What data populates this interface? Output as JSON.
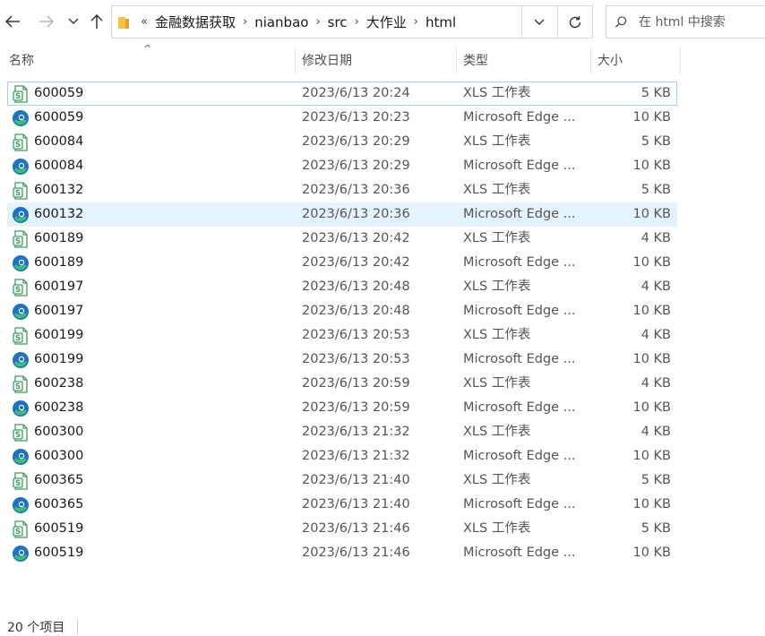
{
  "nav": {
    "back_icon": "arrow-left-icon",
    "forward_icon": "arrow-right-icon",
    "recent_icon": "chevron-down-icon",
    "up_icon": "arrow-up-icon"
  },
  "address": {
    "overflow": "«",
    "crumbs": [
      "金融数据获取",
      "nianbao",
      "src",
      "大作业",
      "html"
    ]
  },
  "search": {
    "placeholder": "在 html 中搜索"
  },
  "columns": {
    "name": "名称",
    "modified": "修改日期",
    "type": "类型",
    "size": "大小"
  },
  "colors": {
    "xls_icon": "#3a9d5a",
    "edge_blue": "#1a73c8",
    "edge_green": "#3fbf6f",
    "selection_border": "#99d1ff",
    "hover_bg": "#e5f3ff"
  },
  "files": [
    {
      "name": "600059",
      "modified": "2023/6/13 20:24",
      "type": "XLS 工作表",
      "size": "5 KB",
      "icon": "xls-icon"
    },
    {
      "name": "600059",
      "modified": "2023/6/13 20:23",
      "type": "Microsoft Edge ...",
      "size": "10 KB",
      "icon": "edge-icon"
    },
    {
      "name": "600084",
      "modified": "2023/6/13 20:29",
      "type": "XLS 工作表",
      "size": "5 KB",
      "icon": "xls-icon"
    },
    {
      "name": "600084",
      "modified": "2023/6/13 20:29",
      "type": "Microsoft Edge ...",
      "size": "10 KB",
      "icon": "edge-icon"
    },
    {
      "name": "600132",
      "modified": "2023/6/13 20:36",
      "type": "XLS 工作表",
      "size": "5 KB",
      "icon": "xls-icon"
    },
    {
      "name": "600132",
      "modified": "2023/6/13 20:36",
      "type": "Microsoft Edge ...",
      "size": "10 KB",
      "icon": "edge-icon"
    },
    {
      "name": "600189",
      "modified": "2023/6/13 20:42",
      "type": "XLS 工作表",
      "size": "4 KB",
      "icon": "xls-icon"
    },
    {
      "name": "600189",
      "modified": "2023/6/13 20:42",
      "type": "Microsoft Edge ...",
      "size": "10 KB",
      "icon": "edge-icon"
    },
    {
      "name": "600197",
      "modified": "2023/6/13 20:48",
      "type": "XLS 工作表",
      "size": "4 KB",
      "icon": "xls-icon"
    },
    {
      "name": "600197",
      "modified": "2023/6/13 20:48",
      "type": "Microsoft Edge ...",
      "size": "10 KB",
      "icon": "edge-icon"
    },
    {
      "name": "600199",
      "modified": "2023/6/13 20:53",
      "type": "XLS 工作表",
      "size": "4 KB",
      "icon": "xls-icon"
    },
    {
      "name": "600199",
      "modified": "2023/6/13 20:53",
      "type": "Microsoft Edge ...",
      "size": "10 KB",
      "icon": "edge-icon"
    },
    {
      "name": "600238",
      "modified": "2023/6/13 20:59",
      "type": "XLS 工作表",
      "size": "4 KB",
      "icon": "xls-icon"
    },
    {
      "name": "600238",
      "modified": "2023/6/13 20:59",
      "type": "Microsoft Edge ...",
      "size": "10 KB",
      "icon": "edge-icon"
    },
    {
      "name": "600300",
      "modified": "2023/6/13 21:32",
      "type": "XLS 工作表",
      "size": "4 KB",
      "icon": "xls-icon"
    },
    {
      "name": "600300",
      "modified": "2023/6/13 21:32",
      "type": "Microsoft Edge ...",
      "size": "10 KB",
      "icon": "edge-icon"
    },
    {
      "name": "600365",
      "modified": "2023/6/13 21:40",
      "type": "XLS 工作表",
      "size": "5 KB",
      "icon": "xls-icon"
    },
    {
      "name": "600365",
      "modified": "2023/6/13 21:40",
      "type": "Microsoft Edge ...",
      "size": "10 KB",
      "icon": "edge-icon"
    },
    {
      "name": "600519",
      "modified": "2023/6/13 21:46",
      "type": "XLS 工作表",
      "size": "5 KB",
      "icon": "xls-icon"
    },
    {
      "name": "600519",
      "modified": "2023/6/13 21:46",
      "type": "Microsoft Edge ...",
      "size": "10 KB",
      "icon": "edge-icon"
    }
  ],
  "selected_index": 0,
  "hover_index": 5,
  "status": {
    "count_text": "20 个项目"
  }
}
